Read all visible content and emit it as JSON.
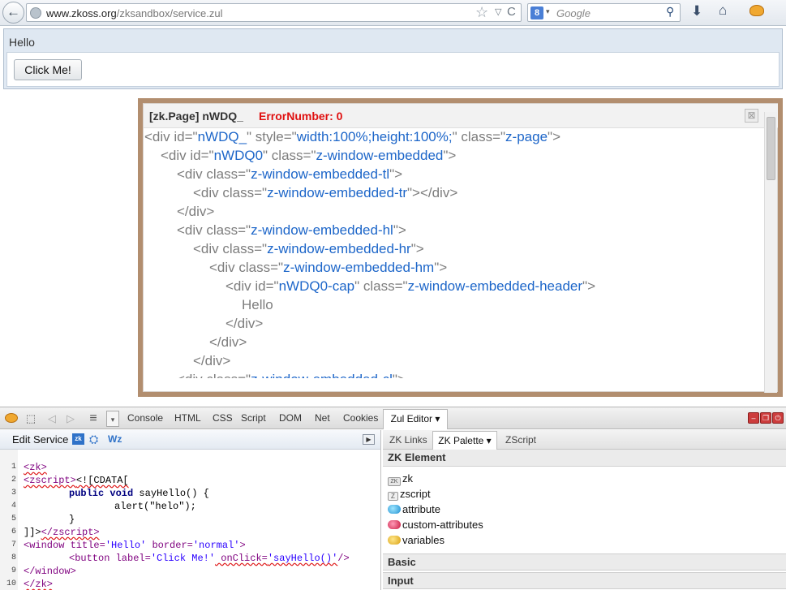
{
  "browser": {
    "url_host": "www.zkoss.org",
    "url_path": "/zksandbox/service.zul",
    "search_engine_label": "8",
    "search_placeholder": "Google",
    "back_glyph": "←",
    "star_glyph": "☆",
    "caret_glyph": "▽",
    "reload_glyph": "C",
    "search_glyph": "⚲",
    "download_glyph": "⬇",
    "home_glyph": "⌂",
    "icons": [
      "back-icon",
      "globe-icon",
      "star-icon",
      "reload-icon",
      "search-engine-icon",
      "search-go-icon",
      "download-icon",
      "home-icon",
      "firebug-icon"
    ]
  },
  "zk_window": {
    "title": "Hello",
    "button_label": "Click Me!"
  },
  "inspector": {
    "title": "[zk.Page] nWDQ_",
    "error_label": "ErrorNumber: 0",
    "close_glyph": "⊠",
    "lines": [
      {
        "parts": [
          "<div id=\"",
          "nWDQ_",
          "\" style=\"",
          "width:100%;height:100%;",
          "\" class=\"",
          "z-page",
          "\">"
        ]
      },
      {
        "parts": [
          "<div id=\"",
          "nWDQ0",
          "\" class=\"",
          "z-window-embedded",
          "\">"
        ]
      },
      {
        "parts": [
          "<div class=\"",
          "z-window-embedded-tl",
          "\">"
        ]
      },
      {
        "parts": [
          "<div class=\"",
          "z-window-embedded-tr",
          "\"></div>"
        ]
      },
      {
        "parts": [
          "</div>"
        ]
      },
      {
        "parts": [
          "<div class=\"",
          "z-window-embedded-hl",
          "\">"
        ]
      },
      {
        "parts": [
          "<div class=\"",
          "z-window-embedded-hr",
          "\">"
        ]
      },
      {
        "parts": [
          "<div class=\"",
          "z-window-embedded-hm",
          "\">"
        ]
      },
      {
        "parts": [
          "<div id=\"",
          "nWDQ0-cap",
          "\" class=\"",
          "z-window-embedded-header",
          "\">"
        ]
      },
      {
        "parts": [
          "Hello"
        ]
      },
      {
        "parts": [
          "</div>"
        ]
      },
      {
        "parts": [
          "</div>"
        ]
      },
      {
        "parts": [
          "</div>"
        ]
      },
      {
        "parts": [
          "<div class=\"",
          "z-window-embedded-cl",
          "\">"
        ]
      }
    ]
  },
  "firebug": {
    "tabs": [
      "Console",
      "HTML",
      "CSS",
      "Script",
      "DOM",
      "Net",
      "Cookies"
    ],
    "active_tab": "Zul Editor ▾",
    "menu_glyph": "≡",
    "dropdown_glyph": "▾",
    "prev_glyph": "◁",
    "next_glyph": "▷",
    "inspect_glyph": "⬚",
    "win_minimize": "–",
    "win_restore": "❐",
    "win_close": "⏻"
  },
  "editor": {
    "label": "Edit Service",
    "icon_a_label": "zk",
    "icon_b_glyph": "⛭",
    "icon_c_label": "Wz",
    "expand_glyph": "▶",
    "line_numbers": [
      "1",
      "2",
      "3",
      "4",
      "5",
      "6",
      "7",
      "8",
      "9",
      "10"
    ],
    "code": {
      "l1_tag": "<zk>",
      "l2_tag": "<zscript>",
      "l2_rest": "<![CDATA[",
      "l3_kw": "public void",
      "l3_rest": " sayHello() {",
      "l4": "alert(\"helo\");",
      "l5": "}",
      "l6_a": "]]>",
      "l6_tag": "</zscript>",
      "l7_open": "<window ",
      "l7_attr1": "title=",
      "l7_val1": "'Hello'",
      "l7_attr2": " border=",
      "l7_val2": "'normal'",
      "l7_close": ">",
      "l8_open": "<button ",
      "l8_attr1": "label=",
      "l8_val1": "'Click Me!'",
      "l8_attr2": " onClick=",
      "l8_val2": "'sayHello()'",
      "l8_close": "/>",
      "l9_tag": "</window>",
      "l10_tag": "</zk>"
    }
  },
  "palette": {
    "tabs": [
      "ZK Links",
      "ZK Palette ▾",
      "ZScript"
    ],
    "section_title": "ZK Element",
    "items": [
      {
        "label": "zk",
        "icon": "zk-tag-icon"
      },
      {
        "label": "zscript",
        "icon": "zscript-icon"
      },
      {
        "label": "attribute",
        "icon": "attribute-icon"
      },
      {
        "label": "custom-attributes",
        "icon": "custom-attributes-icon"
      },
      {
        "label": "variables",
        "icon": "variables-icon"
      }
    ],
    "zk_icon_label": "ZK",
    "zscript_icon_label": "Z",
    "sections": [
      "Basic",
      "Input"
    ]
  }
}
